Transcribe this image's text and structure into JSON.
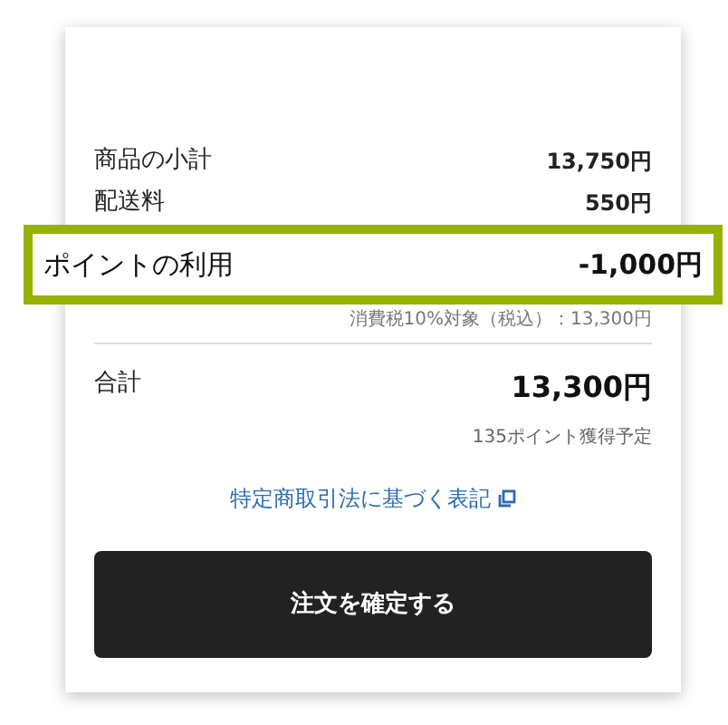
{
  "summary_rows": [
    {
      "label": "商品の小計",
      "value": "13,750円"
    },
    {
      "label": "配送料",
      "value": "550円"
    }
  ],
  "highlight": {
    "label": "ポイントの利用",
    "value": "-1,000円"
  },
  "tax_note": "消費税10%対象（税込）：13,300円",
  "total": {
    "label": "合計",
    "value": "13,300円"
  },
  "points_note": "135ポイント獲得予定",
  "legal_link": "特定商取引法に基づく表記",
  "confirm_button": "注文を確定する"
}
